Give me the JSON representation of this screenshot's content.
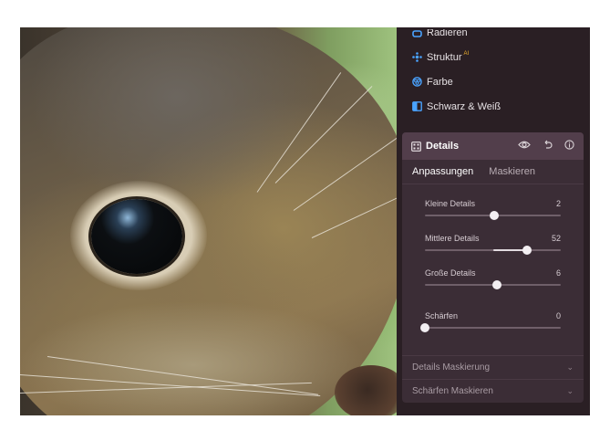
{
  "tools": [
    {
      "label": "Radieren",
      "icon": "eraser-icon",
      "color": "#4aa3ff"
    },
    {
      "label": "Struktur",
      "icon": "structure-icon",
      "color": "#4aa3ff",
      "badge": "AI"
    },
    {
      "label": "Farbe",
      "icon": "color-icon",
      "color": "#4aa3ff"
    },
    {
      "label": "Schwarz & Weiß",
      "icon": "black-white-icon",
      "color": "#4aa3ff"
    }
  ],
  "details": {
    "title": "Details",
    "tabs": [
      "Anpassungen",
      "Maskieren"
    ],
    "sliders": [
      {
        "label": "Kleine Details",
        "value": "2",
        "level": 0.51,
        "fill_from": 0.5
      },
      {
        "label": "Mittlere Details",
        "value": "52",
        "level": 0.75,
        "fill_from": 0.5
      },
      {
        "label": "Große Details",
        "value": "6",
        "level": 0.53,
        "fill_from": 0.5
      },
      {
        "label": "Schärfen",
        "value": "0",
        "level": 0.0,
        "fill_from": 0.0
      }
    ],
    "sections": [
      "Details Maskierung",
      "Schärfen Maskieren"
    ]
  },
  "colors": {
    "panel_bg": "#2a1f24",
    "card_bg": "#3b2d36",
    "header_bg": "#523e4b",
    "accent": "#4aa3ff"
  }
}
